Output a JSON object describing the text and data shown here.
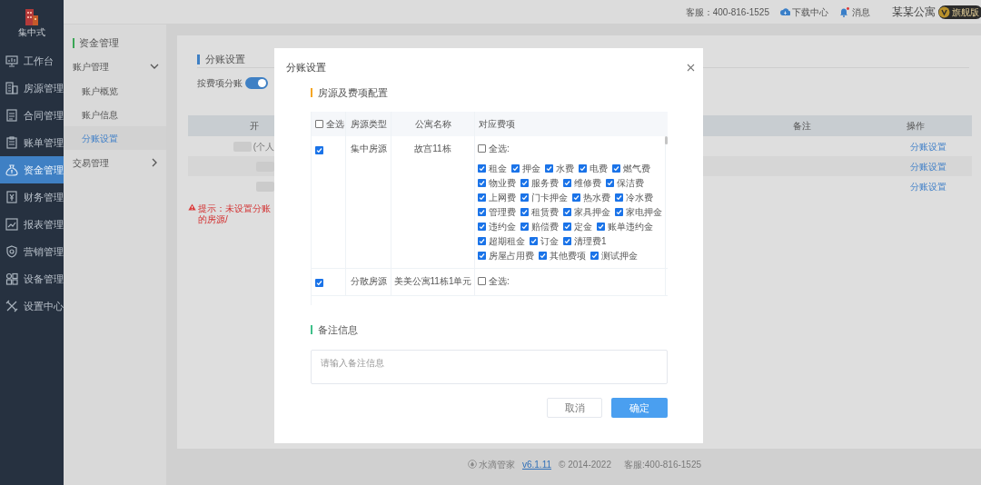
{
  "sidebar": {
    "logo_label": "集中式",
    "items": [
      {
        "label": "工作台",
        "selected": false
      },
      {
        "label": "房源管理",
        "selected": false
      },
      {
        "label": "合同管理",
        "selected": false
      },
      {
        "label": "账单管理",
        "selected": false
      },
      {
        "label": "资金管理",
        "selected": true
      },
      {
        "label": "财务管理",
        "selected": false
      },
      {
        "label": "报表管理",
        "selected": false
      },
      {
        "label": "营销管理",
        "selected": false
      },
      {
        "label": "设备管理",
        "selected": false
      },
      {
        "label": "设置中心",
        "selected": false
      }
    ]
  },
  "top_bar": {
    "service": "客服：400-816-1525",
    "download": "下载中心",
    "messages": "消息",
    "unread": true,
    "company": "某某公寓",
    "edition": "旗舰版"
  },
  "submenu": {
    "title": "资金管理",
    "groups": [
      {
        "label": "账户管理",
        "expanded": true,
        "children": [
          {
            "label": "账户概览",
            "selected": false
          },
          {
            "label": "账户信息",
            "selected": false
          },
          {
            "label": "分账设置",
            "selected": true
          }
        ]
      },
      {
        "label": "交易管理",
        "expanded": false
      }
    ]
  },
  "page": {
    "title": "分账设置",
    "toggle": {
      "label": "按费项分账",
      "on": true
    },
    "table": {
      "columns": [
        "开",
        "备注",
        "操作"
      ],
      "rows": [
        {
          "column_1": "(个人",
          "action": "分账设置"
        },
        {
          "action": "分账设置"
        },
        {
          "action": "分账设置"
        }
      ]
    },
    "warning": "提示：未设置分账的房源/"
  },
  "dialog": {
    "title": "分账设置",
    "section_1": "房源及费项配置",
    "columns": [
      "全选",
      "房源类型",
      "公寓名称",
      "对应费项"
    ],
    "select_all_checked": false,
    "rows": [
      {
        "checked": true,
        "type": "集中房源",
        "name": "故宫11栋",
        "all_label": "全选:",
        "all_checked": false,
        "fees": [
          {
            "label": "租金",
            "checked": true
          },
          {
            "label": "押金",
            "checked": true
          },
          {
            "label": "水费",
            "checked": true
          },
          {
            "label": "电费",
            "checked": true
          },
          {
            "label": "燃气费",
            "checked": true
          },
          {
            "label": "物业费",
            "checked": true
          },
          {
            "label": "服务费",
            "checked": true
          },
          {
            "label": "维修费",
            "checked": true
          },
          {
            "label": "保洁费",
            "checked": true
          },
          {
            "label": "上网费",
            "checked": true
          },
          {
            "label": "门卡押金",
            "checked": true
          },
          {
            "label": "热水费",
            "checked": true
          },
          {
            "label": "冷水费",
            "checked": true
          },
          {
            "label": "管理费",
            "checked": true
          },
          {
            "label": "租赁费",
            "checked": true
          },
          {
            "label": "家具押金",
            "checked": true
          },
          {
            "label": "家电押金",
            "checked": true
          },
          {
            "label": "违约金",
            "checked": true
          },
          {
            "label": "赔偿费",
            "checked": true
          },
          {
            "label": "定金",
            "checked": true
          },
          {
            "label": "账单违约金",
            "checked": true
          },
          {
            "label": "超期租金",
            "checked": true
          },
          {
            "label": "订金",
            "checked": true
          },
          {
            "label": "清理费1",
            "checked": true
          },
          {
            "label": "房屋占用费",
            "checked": true
          },
          {
            "label": "其他费项",
            "checked": true
          },
          {
            "label": "测试押金",
            "checked": true
          }
        ]
      },
      {
        "checked": true,
        "type": "分散房源",
        "name": "美美公寓11栋1单元",
        "all_label": "全选:",
        "all_checked": false,
        "fees": []
      }
    ],
    "section_2": "备注信息",
    "remark": {
      "placeholder": "请输入备注信息"
    },
    "cancel": "取消",
    "ok": "确定"
  },
  "footer": {
    "brand": "水滴管家",
    "version": "v6.1.11",
    "copyright": "© 2014-2022",
    "service": "客服:400-816-1525"
  }
}
